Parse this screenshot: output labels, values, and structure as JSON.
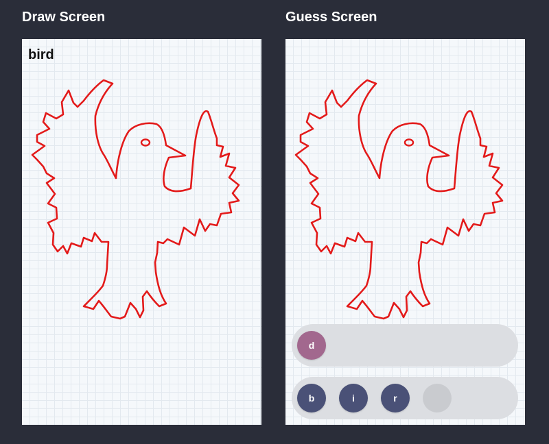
{
  "draw_screen": {
    "title": "Draw Screen",
    "word": "bird"
  },
  "guess_screen": {
    "title": "Guess Screen",
    "answer_slots": [
      "d"
    ],
    "letter_choices": [
      "b",
      "i",
      "r",
      ""
    ]
  },
  "colors": {
    "background": "#2a2d39",
    "canvas": "#f5f8fb",
    "stroke": "#e31a1a",
    "answer_tile": "#a2688e",
    "letter_tile": "#4a5177",
    "empty_tile": "#c9cbcf",
    "tray": "#dcdee2"
  }
}
